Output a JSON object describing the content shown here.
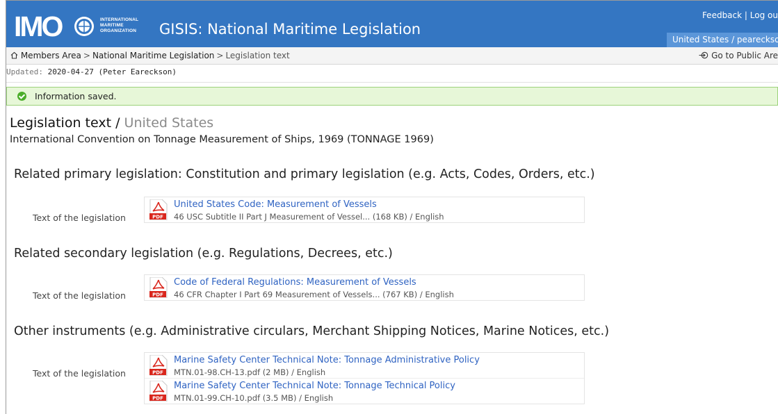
{
  "header": {
    "logo_letters": "IMO",
    "logo_text": [
      "INTERNATIONAL",
      "MARITIME",
      "ORGANIZATION"
    ],
    "app_title": "GISIS: National Maritime Legislation",
    "feedback_label": "Feedback",
    "logout_label": "Log ou",
    "link_separator": "|",
    "user_label": "United States / pearecksor"
  },
  "breadcrumb": {
    "home_icon": "home-icon",
    "items": [
      "Members Area",
      "National Maritime Legislation",
      "Legislation text"
    ],
    "separator": ">",
    "public_link_icon": "arrow-circle-icon",
    "public_link": "Go to Public Are"
  },
  "updated": {
    "label": "Updated:",
    "value": "2020-04-27  (Peter Eareckson)"
  },
  "message": {
    "icon": "check-circle-icon",
    "text": "Information saved."
  },
  "page": {
    "title": "Legislation text /",
    "country": "United States",
    "subtitle": "International Convention on Tonnage Measurement of Ships, 1969 (TONNAGE 1969)"
  },
  "sections": [
    {
      "heading": "Related primary legislation: Constitution and primary legislation (e.g. Acts, Codes, Orders, etc.)",
      "row_label": "Text of the legislation",
      "documents": [
        {
          "title": "United States Code: Measurement of Vessels",
          "meta": "46 USC Subtitle II Part J Measurement of Vessel... (168 KB) / English",
          "icon": "pdf-icon"
        }
      ]
    },
    {
      "heading": "Related secondary legislation (e.g. Regulations, Decrees, etc.)",
      "row_label": "Text of the legislation",
      "documents": [
        {
          "title": "Code of Federal Regulations: Measurement of Vessels",
          "meta": "46 CFR Chapter I Part 69 Measurement of Vessels... (767 KB) / English",
          "icon": "pdf-icon"
        }
      ]
    },
    {
      "heading": "Other instruments (e.g. Administrative circulars, Merchant Shipping Notices, Marine Notices, etc.)",
      "row_label": "Text of the legislation",
      "documents": [
        {
          "title": "Marine Safety Center Technical Note: Tonnage Administrative Policy",
          "meta": "MTN.01-98.CH-13.pdf (2 MB) / English",
          "icon": "pdf-icon"
        },
        {
          "title": "Marine Safety Center Technical Note: Tonnage Technical Policy",
          "meta": "MTN.01-99.CH-10.pdf (3.5 MB) / English",
          "icon": "pdf-icon"
        }
      ]
    }
  ],
  "pdf_badge_text": "PDF",
  "colors": {
    "header_bg": "#3476c2",
    "link": "#2f63c2",
    "success_bg": "#e7f7d8",
    "success_icon": "#4cae2a",
    "pdf_red": "#d9261c"
  }
}
